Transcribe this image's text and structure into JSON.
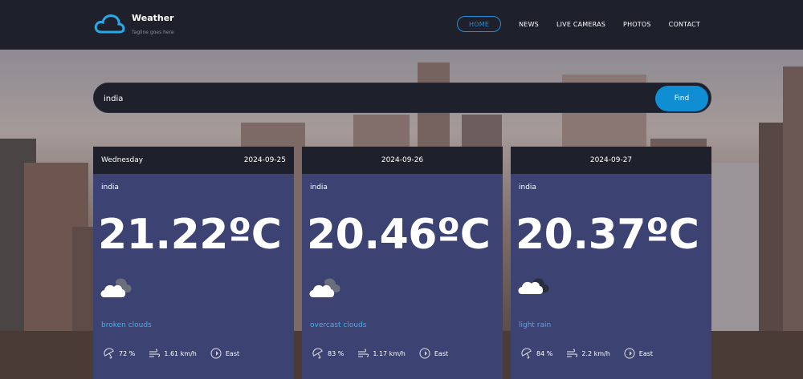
{
  "brand": {
    "title": "Weather",
    "tagline": "Tagline goes here"
  },
  "nav": [
    {
      "label": "HOME",
      "active": true
    },
    {
      "label": "NEWS",
      "active": false
    },
    {
      "label": "LIVE CAMERAS",
      "active": false
    },
    {
      "label": "PHOTOS",
      "active": false
    },
    {
      "label": "CONTACT",
      "active": false
    }
  ],
  "search": {
    "value": "india",
    "button_label": "Find"
  },
  "forecast": [
    {
      "day": "Wednesday",
      "date": "2024-09-25",
      "location": "india",
      "temperature": "21.22ºC",
      "icon": "cloud-icon",
      "description": "broken clouds",
      "humidity": "72 %",
      "wind": "1.61 km/h",
      "direction": "East"
    },
    {
      "day": "",
      "date": "2024-09-26",
      "location": "india",
      "temperature": "20.46ºC",
      "icon": "cloud-icon",
      "description": "overcast clouds",
      "humidity": "83 %",
      "wind": "1.17 km/h",
      "direction": "East"
    },
    {
      "day": "",
      "date": "2024-09-27",
      "location": "india",
      "temperature": "20.37ºC",
      "icon": "cloud-icon",
      "description": "light rain",
      "humidity": "84 %",
      "wind": "2.2 km/h",
      "direction": "East"
    }
  ],
  "colors": {
    "accent": "#0f8ed4",
    "card": "#3c4272",
    "header": "#1e202b",
    "description": "#38b6f0"
  }
}
